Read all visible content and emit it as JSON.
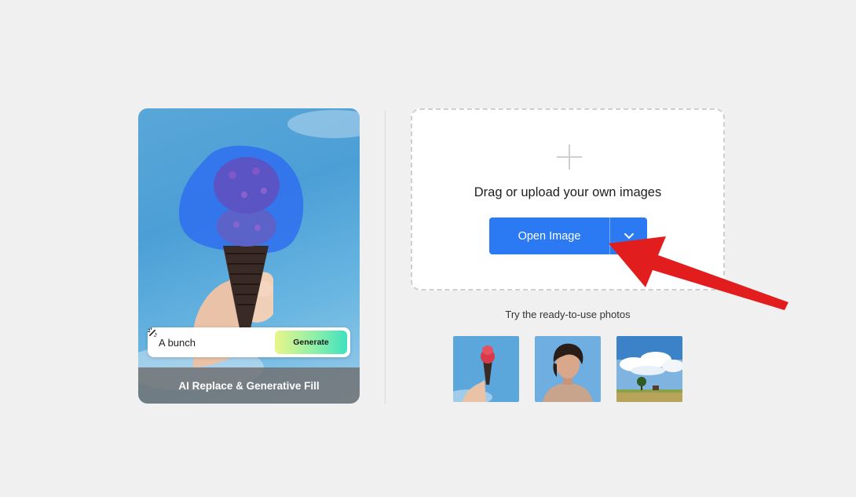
{
  "promo": {
    "prompt_text": "A bunch",
    "generate_label": "Generate",
    "caption": "AI Replace & Generative Fill"
  },
  "upload": {
    "drop_title": "Drag or upload your own images",
    "open_button": "Open Image"
  },
  "samples": {
    "label": "Try the ready-to-use photos",
    "items": [
      {
        "name": "ice-cream-sample",
        "icon": "ice-cream-photo"
      },
      {
        "name": "portrait-sample",
        "icon": "woman-portrait-photo"
      },
      {
        "name": "landscape-sample",
        "icon": "tree-field-photo"
      }
    ]
  },
  "colors": {
    "primary": "#2b79f3",
    "arrow": "#e11d1d",
    "background": "#f0f0f0"
  }
}
